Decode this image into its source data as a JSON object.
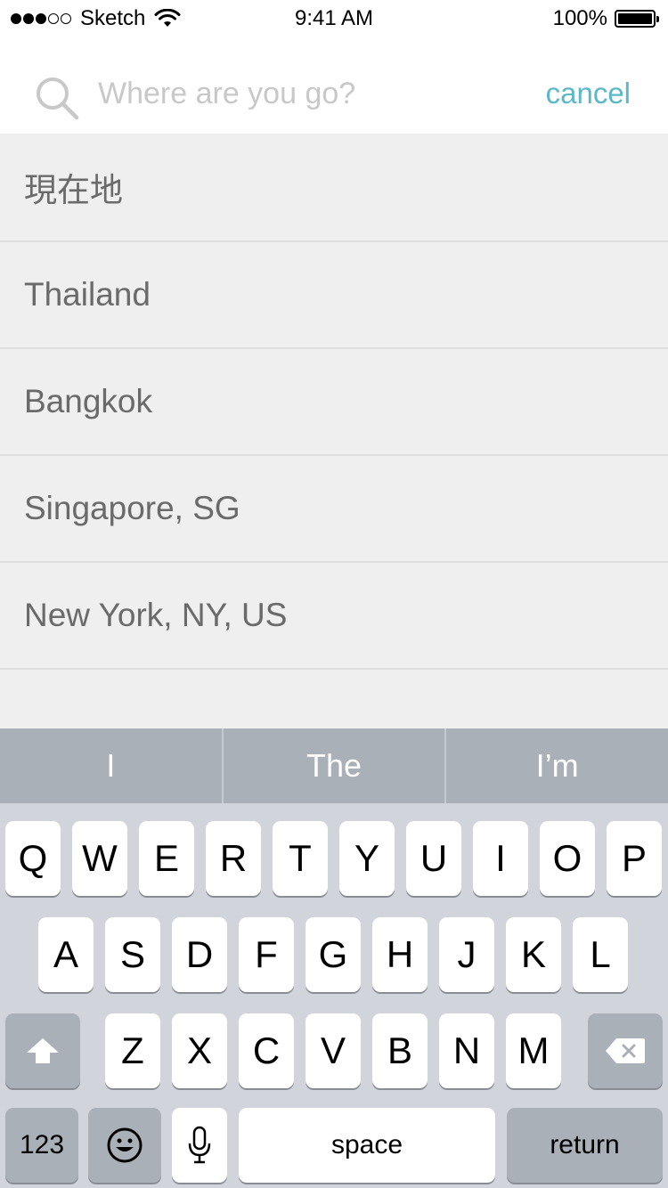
{
  "status_bar": {
    "carrier": "Sketch",
    "time": "9:41 AM",
    "battery_percent": "100%",
    "signal_bars": 3,
    "signal_total": 5
  },
  "search": {
    "placeholder": "Where are you go?",
    "value": "",
    "cancel_label": "cancel",
    "accent_color": "#5bb8c9"
  },
  "locations": [
    "現在地",
    "Thailand",
    "Bangkok",
    "Singapore, SG",
    "New York, NY, US"
  ],
  "keyboard": {
    "suggestions": [
      "I",
      "The",
      "I’m"
    ],
    "row1": [
      "Q",
      "W",
      "E",
      "R",
      "T",
      "Y",
      "U",
      "I",
      "O",
      "P"
    ],
    "row2": [
      "A",
      "S",
      "D",
      "F",
      "G",
      "H",
      "J",
      "K",
      "L"
    ],
    "row3": [
      "Z",
      "X",
      "C",
      "V",
      "B",
      "N",
      "M"
    ],
    "numbers_label": "123",
    "space_label": "space",
    "return_label": "return",
    "icons": {
      "shift": "shift-icon",
      "delete": "delete-icon",
      "emoji": "emoji-icon",
      "mic": "microphone-icon"
    }
  }
}
